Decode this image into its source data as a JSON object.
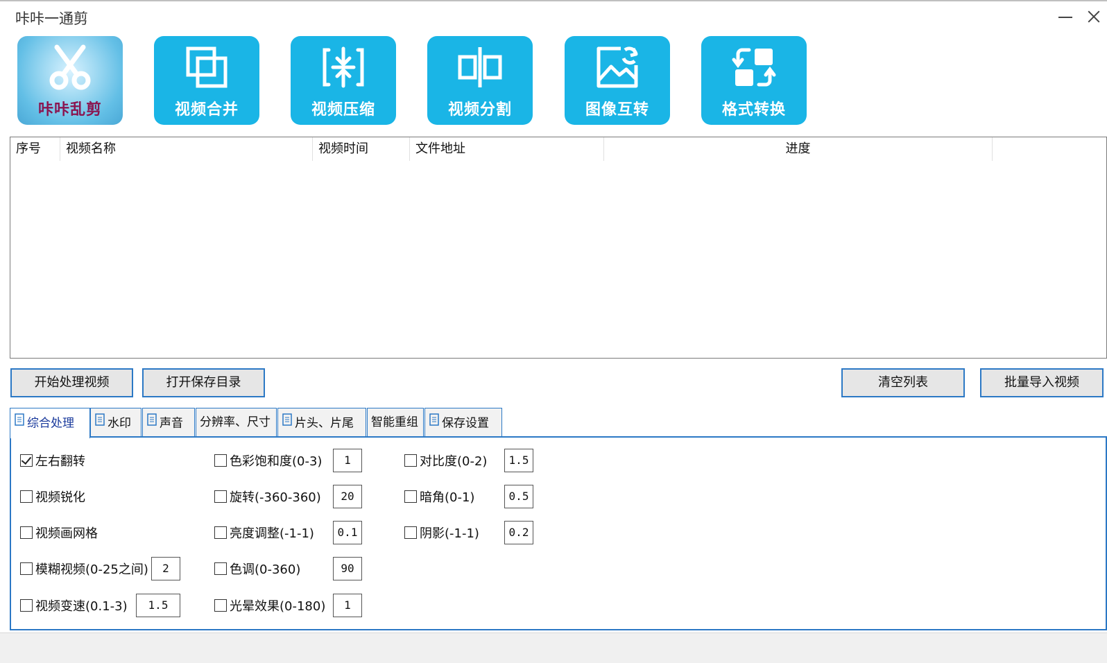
{
  "window": {
    "title": "咔咔一通剪"
  },
  "toolbar": [
    {
      "label": "咔咔乱剪",
      "icon": "scissors-icon"
    },
    {
      "label": "视频合并",
      "icon": "merge-icon"
    },
    {
      "label": "视频压缩",
      "icon": "compress-icon"
    },
    {
      "label": "视频分割",
      "icon": "split-icon"
    },
    {
      "label": "图像互转",
      "icon": "image-convert-icon"
    },
    {
      "label": "格式转换",
      "icon": "format-convert-icon"
    }
  ],
  "table": {
    "columns": [
      "序号",
      "视频名称",
      "视频时间",
      "文件地址",
      "进度"
    ],
    "rows": []
  },
  "actions": {
    "start": "开始处理视频",
    "open_dir": "打开保存目录",
    "clear": "清空列表",
    "import": "批量导入视频"
  },
  "tabs": [
    {
      "label": "综合处理",
      "active": true
    },
    {
      "label": "水印",
      "active": false
    },
    {
      "label": "声音",
      "active": false
    },
    {
      "label": "分辨率、尺寸",
      "active": false
    },
    {
      "label": "片头、片尾",
      "active": false
    },
    {
      "label": "智能重组",
      "active": false
    },
    {
      "label": "保存设置",
      "active": false
    }
  ],
  "options": {
    "col1": [
      {
        "label": "左右翻转",
        "checked": true
      },
      {
        "label": "视频锐化",
        "checked": false
      },
      {
        "label": "视频画网格",
        "checked": false
      },
      {
        "label": "模糊视频(0-25之间)",
        "checked": false,
        "value": "2"
      },
      {
        "label": "视频变速(0.1-3)",
        "checked": false,
        "value": "1.5"
      }
    ],
    "col2": [
      {
        "label": "色彩饱和度(0-3)",
        "checked": false,
        "value": "1"
      },
      {
        "label": "旋转(-360-360)",
        "checked": false,
        "value": "20"
      },
      {
        "label": "亮度调整(-1-1)",
        "checked": false,
        "value": "0.1"
      },
      {
        "label": "色调(0-360)",
        "checked": false,
        "value": "90"
      },
      {
        "label": "光晕效果(0-180)",
        "checked": false,
        "value": "1"
      }
    ],
    "col3": [
      {
        "label": "对比度(0-2)",
        "checked": false,
        "value": "1.5"
      },
      {
        "label": "暗角(0-1)",
        "checked": false,
        "value": "0.5"
      },
      {
        "label": "阴影(-1-1)",
        "checked": false,
        "value": "0.2"
      }
    ]
  },
  "colors": {
    "accent": "#1ab5e6",
    "border": "#2b78c5",
    "logo_text": "#8a1550"
  }
}
